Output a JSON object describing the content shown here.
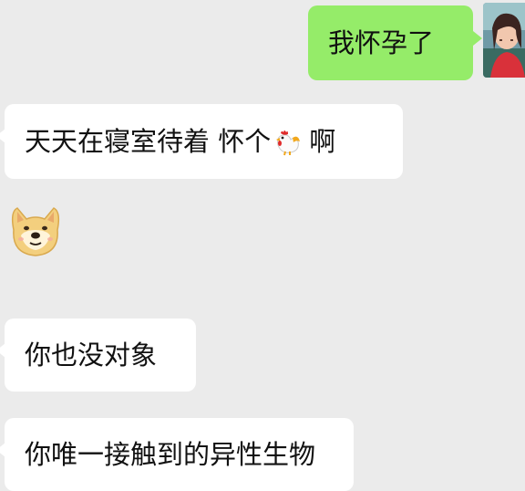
{
  "messages": [
    {
      "side": "out",
      "text": "我怀孕了"
    },
    {
      "side": "in",
      "text_before": "天天在寝室待着 怀个",
      "emoji": "rooster-emoji",
      "text_after": "啊"
    },
    {
      "side": "in",
      "sticker": "doge-emoji"
    },
    {
      "side": "in",
      "text": "你也没对象"
    },
    {
      "side": "in",
      "text": "你唯一接触到的异性生物"
    }
  ],
  "colors": {
    "background": "#ebebeb",
    "outgoing_bubble": "#95ec69",
    "incoming_bubble": "#ffffff",
    "text": "#111111"
  }
}
